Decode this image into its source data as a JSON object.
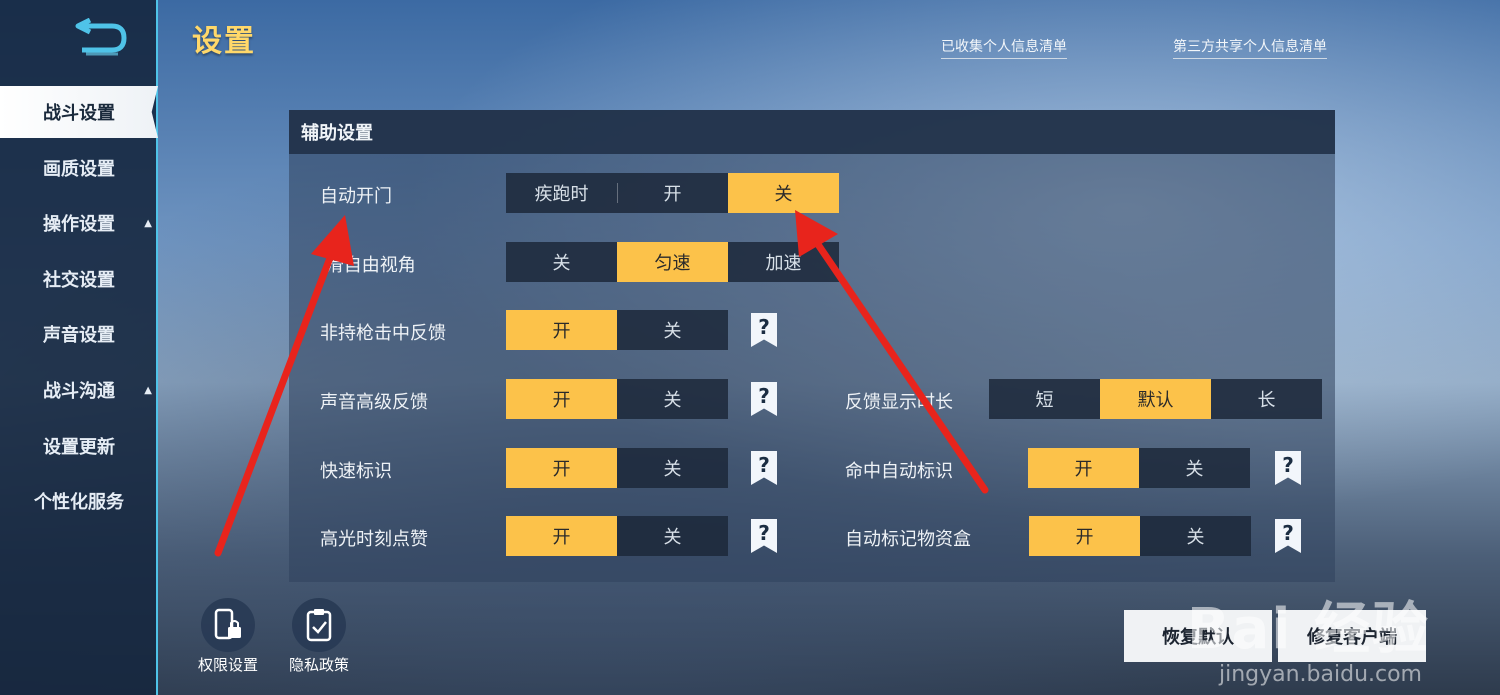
{
  "page": {
    "title": "设置",
    "links": [
      "已收集个人信息清单",
      "第三方共享个人信息清单"
    ]
  },
  "sidebar": {
    "items": [
      {
        "label": "战斗设置",
        "active": true,
        "caret": ""
      },
      {
        "label": "画质设置",
        "caret": ""
      },
      {
        "label": "操作设置",
        "caret": "▲"
      },
      {
        "label": "社交设置",
        "caret": ""
      },
      {
        "label": "声音设置",
        "caret": ""
      },
      {
        "label": "战斗沟通",
        "caret": "▲"
      },
      {
        "label": "设置更新",
        "caret": ""
      },
      {
        "label": "个性化服务",
        "caret": ""
      }
    ]
  },
  "panel": {
    "header": "辅助设置",
    "rows": [
      {
        "label": "自动开门",
        "options": [
          "疾跑时",
          "开",
          "关"
        ],
        "selected": 2
      },
      {
        "label": "滑自由视角",
        "options": [
          "关",
          "匀速",
          "加速"
        ],
        "selected": 1
      },
      {
        "label": "非持枪击中反馈",
        "options": [
          "开",
          "关"
        ],
        "selected": 0,
        "help": "?"
      },
      {
        "label": "声音高级反馈",
        "options": [
          "开",
          "关"
        ],
        "selected": 0,
        "help": "?"
      },
      {
        "label": "快速标识",
        "options": [
          "开",
          "关"
        ],
        "selected": 0,
        "help": "?"
      },
      {
        "label": "高光时刻点赞",
        "options": [
          "开",
          "关"
        ],
        "selected": 0,
        "help": "?"
      }
    ],
    "right_rows": [
      {
        "label": "反馈显示时长",
        "options": [
          "短",
          "默认",
          "长"
        ],
        "selected": 1
      },
      {
        "label": "命中自动标识",
        "options": [
          "开",
          "关"
        ],
        "selected": 0,
        "help": "?"
      },
      {
        "label": "自动标记物资盒",
        "options": [
          "开",
          "关"
        ],
        "selected": 0,
        "help": "?"
      }
    ]
  },
  "bottom": {
    "permission_label": "权限设置",
    "privacy_label": "隐私政策",
    "restore_label": "恢复默认",
    "repair_label": "修复客户端"
  },
  "watermark": {
    "main": "Bai 经验",
    "sub": "jingyan.baidu.com"
  },
  "colors": {
    "accent": "#fcc24a",
    "title": "#ffd86a",
    "sidebar_border": "#4fc3e8",
    "arrow": "#e8241c"
  },
  "icons": [
    "back-arrow-icon",
    "help-bookmark-icon",
    "phone-lock-icon",
    "clipboard-check-icon"
  ]
}
